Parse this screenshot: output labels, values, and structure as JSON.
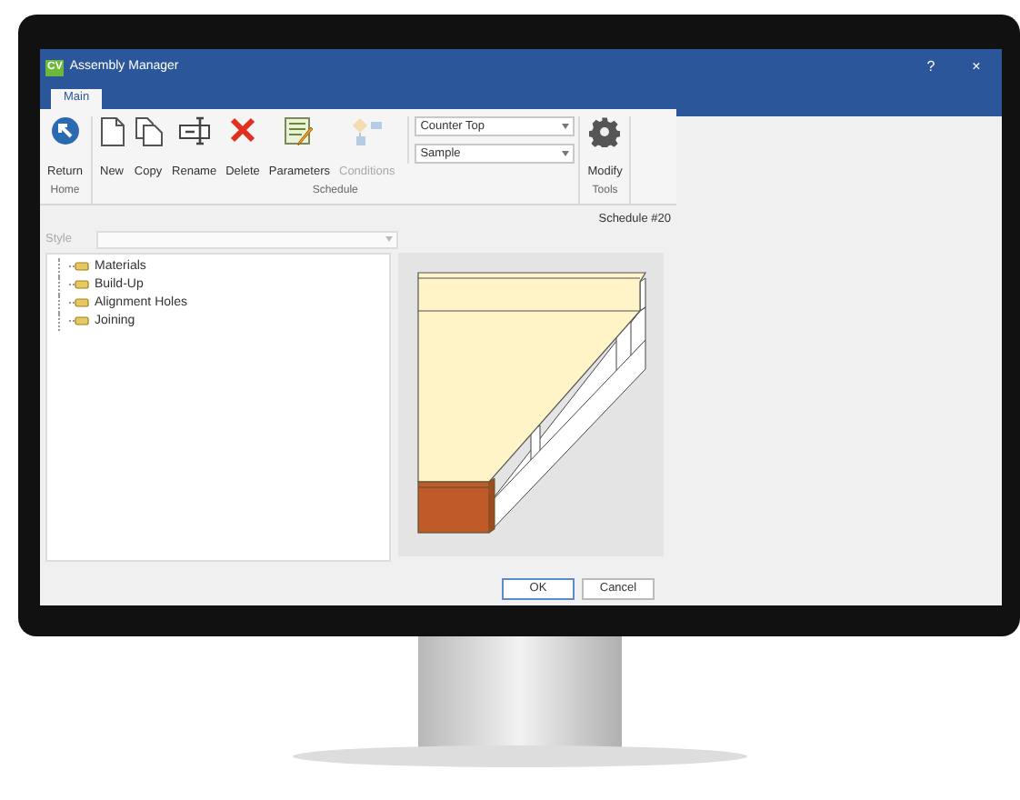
{
  "window": {
    "title": "Assembly Manager",
    "app_icon": "CV",
    "controls": [
      "?",
      "×"
    ]
  },
  "tabs": [
    {
      "label": "Main",
      "selected": true
    }
  ],
  "ribbon": {
    "groups": [
      {
        "label": "Home",
        "items": [
          {
            "kind": "return",
            "label": "Return",
            "disabled": false
          }
        ]
      },
      {
        "label": "Schedule",
        "items": [
          {
            "kind": "new",
            "label": "New",
            "disabled": false
          },
          {
            "kind": "copy",
            "label": "Copy",
            "disabled": false
          },
          {
            "kind": "rename",
            "label": "Rename",
            "disabled": false
          },
          {
            "kind": "delete",
            "label": "Delete",
            "disabled": false
          },
          {
            "kind": "parameters",
            "label": "Parameters",
            "disabled": false
          },
          {
            "kind": "conditions",
            "label": "Conditions",
            "disabled": true
          }
        ],
        "dropdowns": [
          {
            "value": "Counter Top"
          },
          {
            "value": "Sample"
          }
        ]
      },
      {
        "label": "Tools",
        "items": [
          {
            "kind": "modify",
            "label": "Modify",
            "disabled": false
          }
        ]
      }
    ]
  },
  "style_field": {
    "label": "Style",
    "disabled": true
  },
  "schedule_label": "Schedule #20",
  "tree": [
    {
      "label": "Materials"
    },
    {
      "label": "Build-Up"
    },
    {
      "label": "Alignment Holes"
    },
    {
      "label": "Joining"
    }
  ],
  "footer_buttons": [
    {
      "label": "OK",
      "default": true
    },
    {
      "label": "Cancel",
      "default": false
    }
  ]
}
